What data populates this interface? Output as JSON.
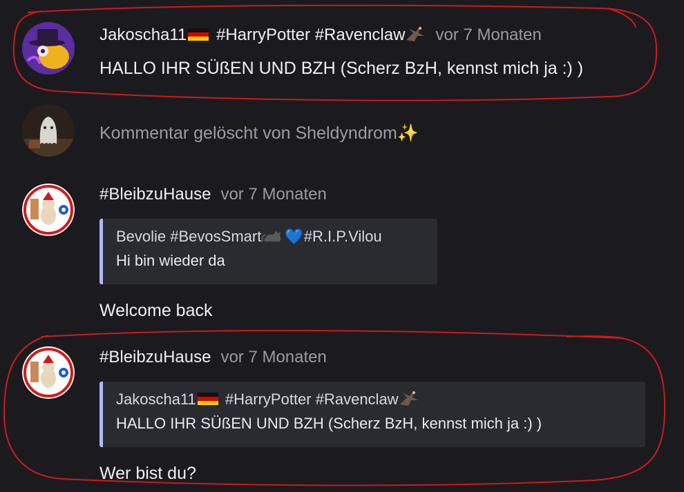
{
  "comments": [
    {
      "author": "Jakoscha11",
      "hashtags": "#HarryPotter #Ravenclaw",
      "time": "vor 7 Monaten",
      "text": "HALLO IHR SÜßEN UND BZH (Scherz BzH, kennst mich ja :) )"
    },
    {
      "deleted_text": "Kommentar gelöscht von Sheldyndrom",
      "sparkle": "✨"
    },
    {
      "author": "#BleibzuHause",
      "time": "vor 7 Monaten",
      "quote": {
        "author": "Bevolie #BevosSmart",
        "heart": "💙",
        "author_suffix": "#R.I.P.Vilou",
        "text": "Hi bin wieder da"
      },
      "text": "Welcome back"
    },
    {
      "author": "#BleibzuHause",
      "time": "vor 7 Monaten",
      "quote": {
        "author": "Jakoscha11",
        "hashtags": "#HarryPotter #Ravenclaw",
        "text": "HALLO IHR SÜßEN UND BZH (Scherz BzH, kennst mich ja :) )"
      },
      "text": "Wer bist du?"
    }
  ],
  "colors": {
    "background": "#1b1b1f",
    "quote_bar": "#aeb8f5",
    "annotation": "#d11a1a"
  }
}
